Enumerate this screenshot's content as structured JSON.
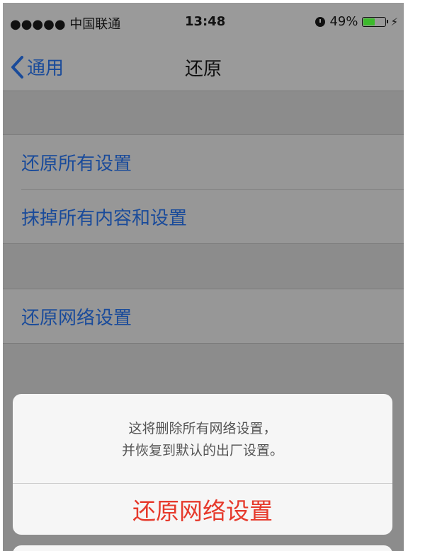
{
  "status_bar": {
    "signal": "●●●●● 中国联通",
    "time": "13:48",
    "battery_percent": "49%",
    "battery_level": 0.49,
    "colors": {
      "battery_fill": "#3cba2c"
    }
  },
  "nav": {
    "back_label": "通用",
    "title": "还原"
  },
  "settings": {
    "group1": [
      {
        "label": "还原所有设置"
      },
      {
        "label": "抹掉所有内容和设置"
      }
    ],
    "group2": [
      {
        "label": "还原网络设置"
      }
    ]
  },
  "action_sheet": {
    "message_line1": "这将删除所有网络设置，",
    "message_line2": "并恢复到默认的出厂设置。",
    "destructive_label": "还原网络设置",
    "colors": {
      "destructive": "#e63a2c",
      "link": "#1a4b9a"
    }
  }
}
